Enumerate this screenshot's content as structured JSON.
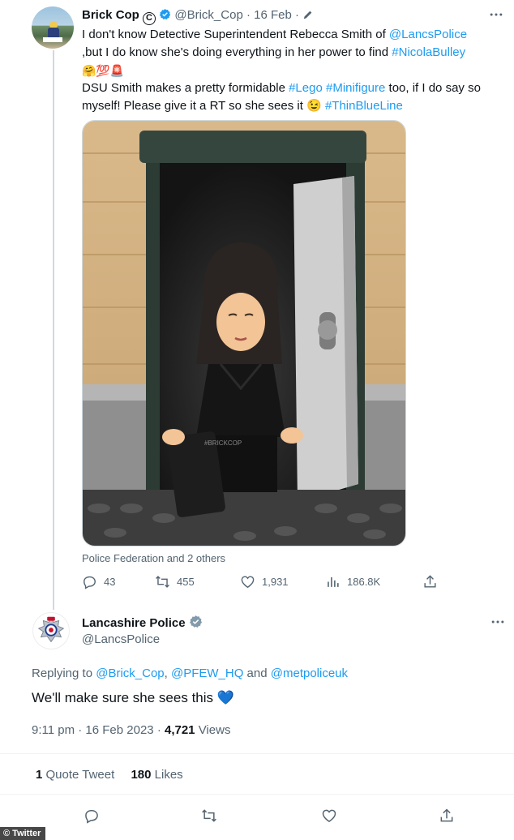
{
  "tweet1": {
    "display_name": "Brick Cop",
    "handle": "@Brick_Cop",
    "separator": "·",
    "date": "16 Feb",
    "line1_text": "I don't know Detective Superintendent Rebecca Smith of ",
    "line1_link": "@LancsPolice",
    "line2_text": ",but I do know she's doing everything in her power to find ",
    "line2_link": "#NicolaBulley",
    "emoji1": "🤗💯🚨",
    "line4_text1": "DSU Smith makes a pretty formidable ",
    "line4_tag1": "#Lego",
    "line4_tag2": "#Minifigure",
    "line4_text2": " too, if I do say so myself! Please give it a RT so she sees it ",
    "line4_emoji": "😉",
    "line4_tag3": "#ThinBlueLine",
    "media_watermark": "#BRICKCOP",
    "tagged": "Police Federation and 2 others",
    "replies": "43",
    "retweets": "455",
    "likes": "1,931",
    "views": "186.8K"
  },
  "tweet2": {
    "display_name": "Lancashire Police",
    "handle": "@LancsPolice",
    "replying_label": "Replying to ",
    "replying_to1": "@Brick_Cop",
    "replying_sep1": ", ",
    "replying_to2": "@PFEW_HQ",
    "replying_and": " and ",
    "replying_to3": "@metpoliceuk",
    "text": "We'll make sure she sees this 💙",
    "time": "9:11 pm · 16 Feb 2023 · ",
    "views_count": "4,721",
    "views_label": " Views",
    "quote_count": "1",
    "quote_label": " Quote Tweet",
    "likes_count": "180",
    "likes_label": " Likes"
  },
  "watermark": "© Twitter",
  "icons": [
    "copyright-icon",
    "verified-icon",
    "edit-icon",
    "more-icon",
    "reply-icon",
    "retweet-icon",
    "like-icon",
    "views-icon",
    "share-icon"
  ],
  "colors": {
    "link": "#1d9bf0",
    "verified": "#1d9bf0",
    "muted": "#536471",
    "heart": "#5ba4e6"
  }
}
